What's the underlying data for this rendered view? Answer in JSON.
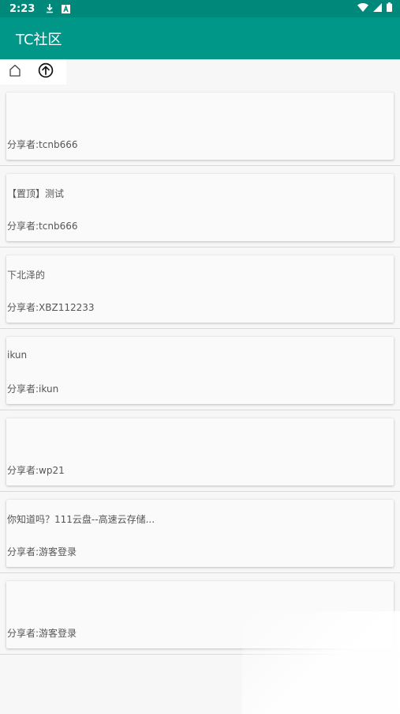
{
  "status_bar": {
    "time": "2:23",
    "icons_left": [
      "download-icon",
      "font-a-icon"
    ],
    "icons_right": [
      "wifi-icon",
      "signal-icon",
      "battery-icon"
    ]
  },
  "app_bar": {
    "title": "TC社区"
  },
  "toolbar": {
    "icons": [
      "home-icon",
      "upload-icon"
    ]
  },
  "posts": [
    {
      "title": "",
      "author": "分享者:tcnb666"
    },
    {
      "title": "【置顶】测试",
      "author": "分享者:tcnb666"
    },
    {
      "title": "下北泽的",
      "author": "分享者:XBZ112233"
    },
    {
      "title": "ikun",
      "author": "分享者:ikun"
    },
    {
      "title": "",
      "author": "分享者:wp21"
    },
    {
      "title": "你知道吗？111云盘--高速云存储...",
      "author": "分享者:游客登录"
    },
    {
      "title": "",
      "author": "分享者:游客登录"
    }
  ],
  "colors": {
    "status_bar": "#00897b",
    "app_bar": "#009688",
    "background": "#f7f7f7",
    "card": "#fafafa",
    "text": "#555555"
  }
}
